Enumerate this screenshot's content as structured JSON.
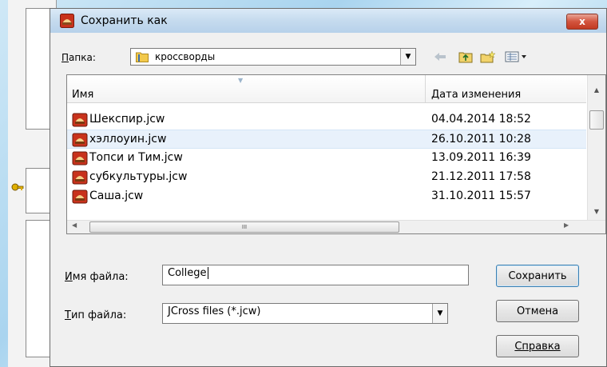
{
  "dialog": {
    "title": "Сохранить как",
    "close_label": "x"
  },
  "folder": {
    "label": "Папка:",
    "value": "кроссворды"
  },
  "list": {
    "col_name": "Имя",
    "col_date": "Дата изменения",
    "files": [
      {
        "name": "Шекспир.jcw",
        "date": "04.04.2014 18:52"
      },
      {
        "name": "хэллоуин.jcw",
        "date": "26.10.2011 10:28"
      },
      {
        "name": "Топси и Тим.jcw",
        "date": "13.09.2011 16:39"
      },
      {
        "name": "субкультуры.jcw",
        "date": "21.12.2011 17:58"
      },
      {
        "name": "Саша.jcw",
        "date": "31.10.2011 15:57"
      }
    ],
    "hscroll_grip": "III"
  },
  "filename": {
    "label": "Имя файла:",
    "value": "College"
  },
  "filetype": {
    "label": "Тип файла:",
    "value": "JCross files (*.jcw)"
  },
  "buttons": {
    "save": "Сохранить",
    "cancel": "Отмена",
    "help": "Справка"
  }
}
